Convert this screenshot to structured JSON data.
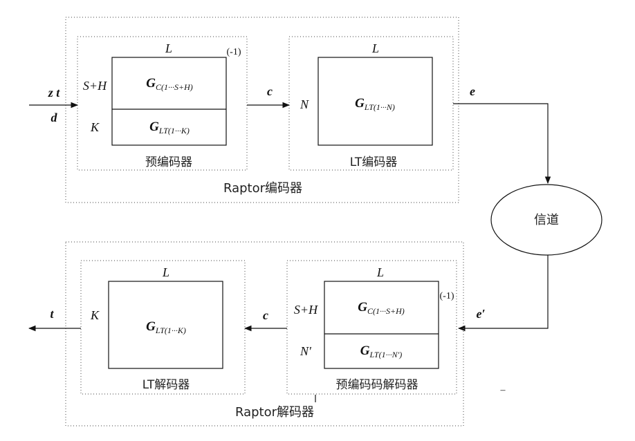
{
  "labels": {
    "raptor_encoder": "Raptor编码器",
    "raptor_decoder": "Raptor解码器",
    "precoder": "预编码器",
    "lt_encoder": "LT编码器",
    "lt_decoder": "LT解码器",
    "pre_decoder": "预编码码解码器",
    "channel": "信道"
  },
  "signals": {
    "input_zt": "z t",
    "input_d": "d",
    "c_top": "c",
    "e_top": "e",
    "e_prime": "e′",
    "c_bottom": "c",
    "output_t": "t"
  },
  "matrix_labels": {
    "L": "L",
    "SH": "S+H",
    "K": "K",
    "N": "N",
    "Nprime": "N′",
    "inverse": "(-1)"
  },
  "matrices": {
    "g_base": "G",
    "gc_sub": "C(1···S+H)",
    "glt_k_sub": "LT(1···K)",
    "glt_n_sub": "LT(1···N)",
    "glt_nprime_sub": "LT(1···N′)"
  },
  "misc": {
    "dash": "–"
  }
}
